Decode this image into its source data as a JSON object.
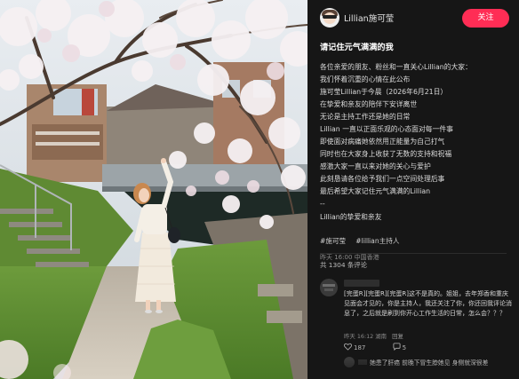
{
  "author": {
    "name": "Lillian施可莹",
    "avatar_icon": "avatar-icon"
  },
  "header": {
    "follow_label": "关注"
  },
  "post": {
    "title": "请记住元气满满的我",
    "lines": [
      "各位亲爱的朋友、粉丝和一直关心Lillian的大家：",
      "我们怀着沉重的心情在此公布",
      "施可莹Lillian于今晨（2026年6月21日）",
      "在挚爱和亲友的陪伴下安详离世",
      "无论是主持工作还是她的日常",
      "Lillian 一直以正面乐观的心态面对每一件事",
      "即使面对病痛她依然用正能量为自己打气",
      "同时也在大家身上收获了无数的支持和祝福",
      "感激大家一直以来对她的关心与爱护",
      "此刻恳请各位给予我们一点空间处理后事",
      "最后希望大家记住元气满满的Lillian",
      "--",
      "Lillian的挚爱和亲友"
    ],
    "tags": [
      "#施可莹",
      "#lillian主持人"
    ],
    "meta": "昨天 16:00 中国香港"
  },
  "comments": {
    "count_label": "共 1304 条评论",
    "items": [
      {
        "text": "[完蛋R][完蛋R][完蛋R]这不是真的。姐姐，去年郑香和重庆见面会才见的，你是主持人，我还关注了你，你还回我评论消息了，之后就是刷到你开心工作生活的日常，怎么会？？？",
        "meta": "昨天 16:12 湖南",
        "reply_label": "回复",
        "likes": "187",
        "replies": "5"
      }
    ],
    "reply_preview": "她患了肝癌 前晚下冒生脖她见 身侧就深很差"
  },
  "colors": {
    "accent": "#ff2d55",
    "panel_bg": "#161616"
  }
}
